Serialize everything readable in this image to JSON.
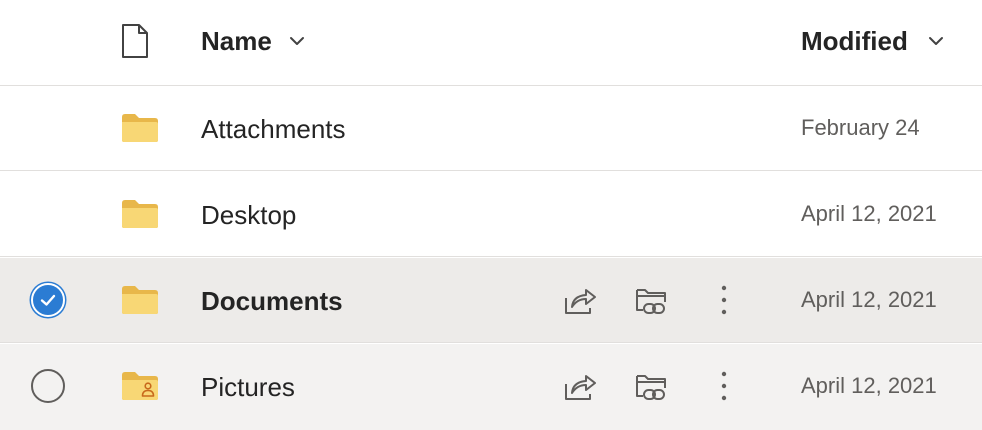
{
  "header": {
    "name_label": "Name",
    "modified_label": "Modified"
  },
  "rows": [
    {
      "name": "Attachments",
      "modified": "February 24",
      "selected": false,
      "icon": "folder-icon"
    },
    {
      "name": "Desktop",
      "modified": "April 12, 2021",
      "selected": false,
      "icon": "folder-icon"
    },
    {
      "name": "Documents",
      "modified": "April 12, 2021",
      "selected": true,
      "icon": "folder-icon"
    },
    {
      "name": "Pictures",
      "modified": "April 12, 2021",
      "selected": false,
      "icon": "shared-folder-icon"
    }
  ],
  "colors": {
    "accent": "#2b7cd3",
    "folder": "#f8d775",
    "folder_back": "#e8b74a",
    "selected_row": "#edebe9",
    "hover_row": "#f3f2f1"
  }
}
